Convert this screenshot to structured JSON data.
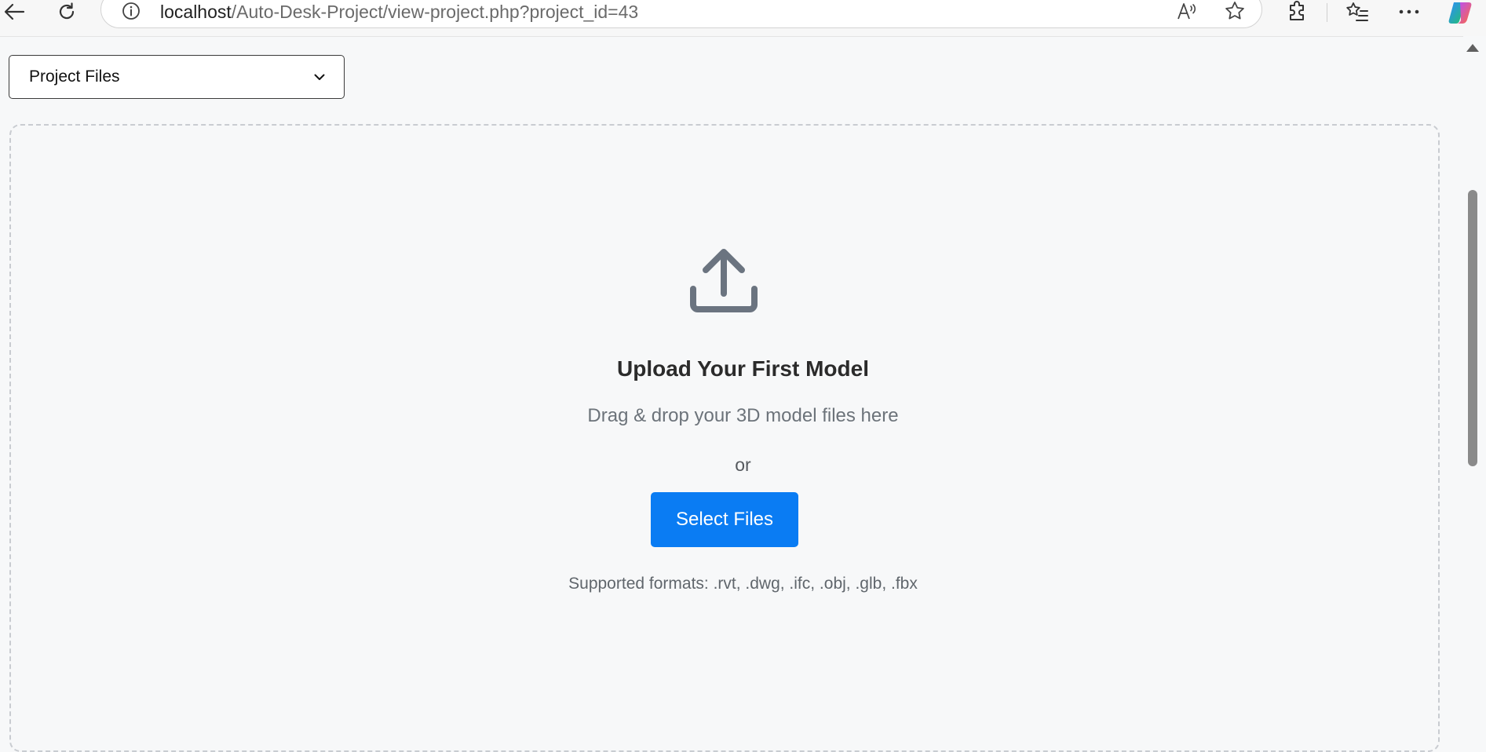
{
  "browser": {
    "url_host": "localhost",
    "url_path": "/Auto-Desk-Project/view-project.php?project_id=43",
    "icons": [
      "back-icon",
      "refresh-icon",
      "site-info-icon",
      "read-aloud-icon",
      "favorite-star-icon",
      "extensions-icon",
      "favorites-icon",
      "more-icon",
      "copilot-icon"
    ]
  },
  "page": {
    "dropdown": {
      "selected": "Project Files"
    },
    "upload": {
      "title": "Upload Your First Model",
      "subtitle": "Drag & drop your 3D model files here",
      "or_text": "or",
      "button_label": "Select Files",
      "formats": "Supported formats: .rvt, .dwg, .ifc, .obj, .glb, .fbx"
    }
  },
  "colors": {
    "accent": "#0a7cf3",
    "icon_gray": "#6b7480",
    "background": "#f7f8f9"
  }
}
